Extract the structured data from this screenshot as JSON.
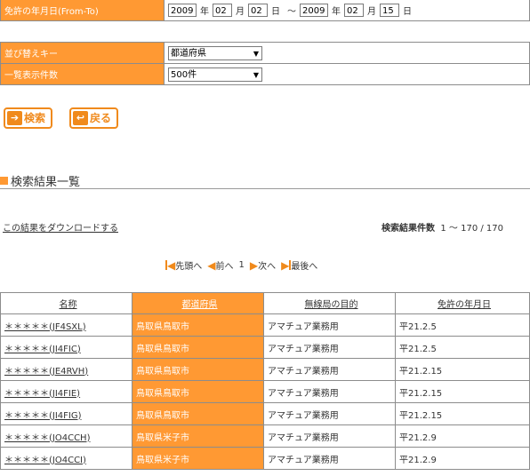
{
  "form": {
    "date_label": "免許の年月日(From-To)",
    "from_year": "2009",
    "from_month": "02",
    "from_day": "02",
    "to_year": "2009",
    "to_month": "02",
    "to_day": "15",
    "year_unit": "年",
    "month_unit": "月",
    "day_unit": "日",
    "tilde": "～",
    "sort_label": "並び替えキー",
    "sort_value": "都道府県",
    "count_label": "一覧表示件数",
    "count_value": "500件"
  },
  "buttons": {
    "search": "検索",
    "back": "戻る"
  },
  "section": {
    "title": "検索結果一覧"
  },
  "download_link": "この結果をダウンロードする",
  "result_count": {
    "label": "検索結果件数",
    "value": "1 ～ 170 / 170"
  },
  "pager": {
    "first": "先頭へ",
    "prev": "前へ",
    "page": "1",
    "next": "次へ",
    "last": "最後へ"
  },
  "table": {
    "headers": [
      "名称",
      "都道府県",
      "無線局の目的",
      "免許の年月日"
    ],
    "rows": [
      [
        "＊＊＊＊＊(JF4SXL)",
        "鳥取県鳥取市",
        "アマチュア業務用",
        "平21.2.5"
      ],
      [
        "＊＊＊＊＊(JI4FIC)",
        "鳥取県鳥取市",
        "アマチュア業務用",
        "平21.2.5"
      ],
      [
        "＊＊＊＊＊(JE4RVH)",
        "鳥取県鳥取市",
        "アマチュア業務用",
        "平21.2.15"
      ],
      [
        "＊＊＊＊＊(JI4FIE)",
        "鳥取県鳥取市",
        "アマチュア業務用",
        "平21.2.15"
      ],
      [
        "＊＊＊＊＊(JI4FIG)",
        "鳥取県鳥取市",
        "アマチュア業務用",
        "平21.2.15"
      ],
      [
        "＊＊＊＊＊(JO4CCH)",
        "鳥取県米子市",
        "アマチュア業務用",
        "平21.2.9"
      ],
      [
        "＊＊＊＊＊(JO4CCI)",
        "鳥取県米子市",
        "アマチュア業務用",
        "平21.2.9"
      ]
    ]
  },
  "colors": {
    "accent": "#ff9933",
    "button_border": "#f08a1c",
    "border": "#8c8c8c"
  }
}
